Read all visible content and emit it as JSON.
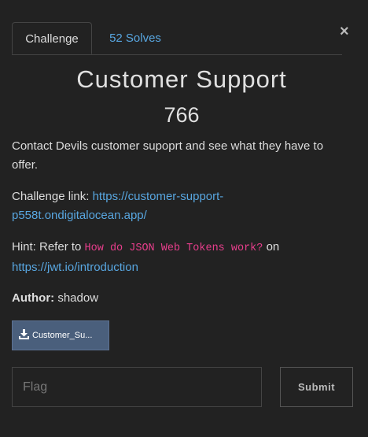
{
  "tabs": [
    {
      "label": "Challenge"
    },
    {
      "label": "52 Solves"
    }
  ],
  "close_glyph": "×",
  "challenge": {
    "title": "Customer Support",
    "points": "766",
    "description": "Contact Devils customer supoprt and see what they have to offer.",
    "link_label": "Challenge link:",
    "link_url": "https://customer-support-p558t.ondigitalocean.app/",
    "hint_prefix": "Hint: Refer to",
    "hint_code": "How do JSON Web Tokens work?",
    "hint_suffix": "on",
    "hint_url": "https://jwt.io/introduction",
    "author_label": "Author:",
    "author": "shadow"
  },
  "file": {
    "label": "Customer_Su...",
    "icon": "download-icon"
  },
  "form": {
    "placeholder": "Flag",
    "submit_label": "Submit"
  },
  "colors": {
    "background": "#222222",
    "link": "#58a6e0",
    "code": "#e83e8c",
    "file_button": "#4a5f7c"
  }
}
